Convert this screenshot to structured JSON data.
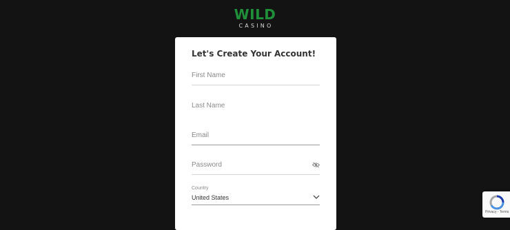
{
  "logo": {
    "word": "WILD",
    "sub": "CASINO"
  },
  "form": {
    "title": "Let's Create Your Account!",
    "first_name_placeholder": "First Name",
    "last_name_placeholder": "Last Name",
    "email_placeholder": "Email",
    "password_placeholder": "Password",
    "country_label": "Country",
    "country_value": "United States"
  },
  "recaptcha": {
    "text": "Privacy - Terms"
  },
  "colors": {
    "background": "#131313",
    "brand_green": "#1f8f3a",
    "card": "#ffffff"
  },
  "icons": {
    "password_toggle": "eye-off-icon",
    "dropdown": "chevron-down-icon",
    "captcha": "recaptcha-icon"
  }
}
